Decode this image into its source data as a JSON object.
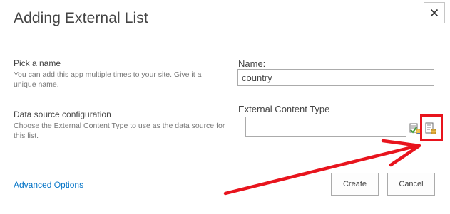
{
  "dialog": {
    "title": "Adding External List",
    "close_icon": "close-icon"
  },
  "name_section": {
    "title": "Pick a name",
    "description_line1": "You can add this app multiple times to your site. Give it a",
    "description_line2": "unique name.",
    "field_label": "Name:",
    "field_value": "country"
  },
  "data_source_section": {
    "title": "Data source configuration",
    "description_line1": "Choose the External Content Type to use as the data source for",
    "description_line2": "this list.",
    "field_label": "External Content Type",
    "field_value": "",
    "check_icon": "check-names-icon",
    "browse_icon": "browse-external-content-type-icon"
  },
  "footer": {
    "advanced_link": "Advanced Options",
    "create_label": "Create",
    "cancel_label": "Cancel"
  },
  "annotation": {
    "color": "#e8141d"
  }
}
